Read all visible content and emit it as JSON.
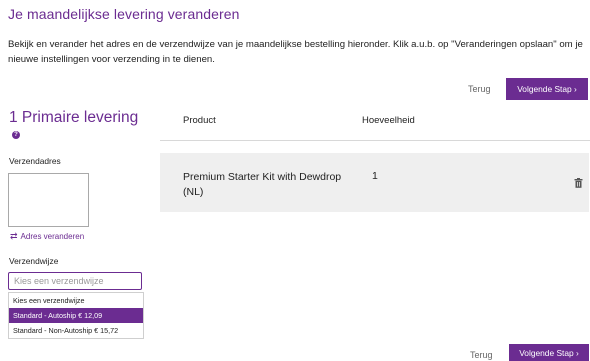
{
  "page": {
    "title": "Je maandelijkse levering veranderen",
    "intro": "Bekijk en verander het adres en de verzendwijze van je maandelijkse bestelling hieronder. Klik a.u.b. op \"Veranderingen opslaan\" om je nieuwe instellingen voor verzending in te dienen."
  },
  "nav": {
    "back_label": "Terug",
    "next_label": "Volgende Stap ›"
  },
  "section": {
    "title": "1 Primaire levering",
    "help_icon": "?"
  },
  "columns": {
    "product": "Product",
    "quantity": "Hoeveelheid"
  },
  "shipping_address": {
    "label": "Verzendadres",
    "change_link": "Adres veranderen"
  },
  "products": [
    {
      "name": "Premium Starter Kit with Dewdrop (NL)",
      "quantity": "1"
    }
  ],
  "shipping_method": {
    "label": "Verzendwijze",
    "placeholder": "Kies een verzendwijze",
    "options": [
      "Kies een verzendwijze",
      "Standard - Autoship € 12,09",
      "Standard - Non-Autoship € 15,72"
    ],
    "highlighted_index": 1
  },
  "colors": {
    "accent": "#6b2c91",
    "panel": "#efefef"
  }
}
